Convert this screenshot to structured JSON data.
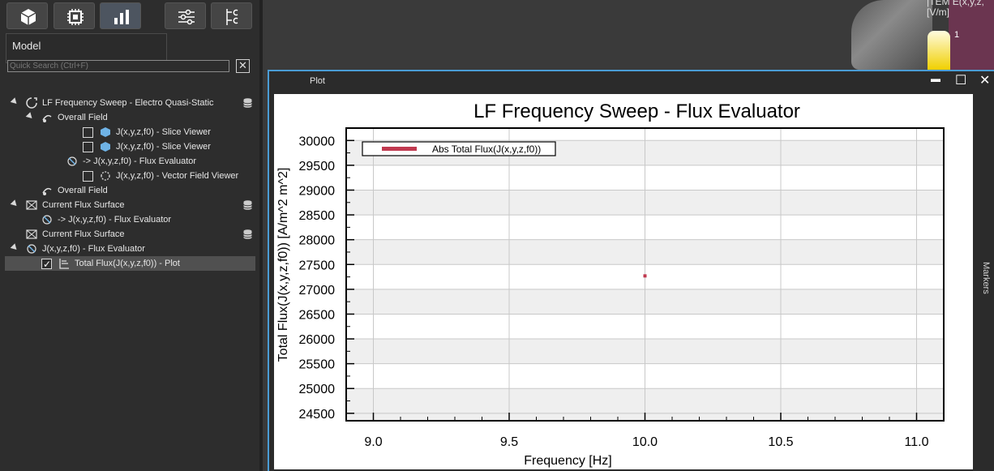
{
  "toolbar": {
    "buttons": [
      {
        "icon": "cube-icon"
      },
      {
        "icon": "chip-icon"
      },
      {
        "icon": "bar-chart-icon"
      },
      {
        "icon": "sliders-icon"
      },
      {
        "icon": "tree-structure-icon"
      }
    ]
  },
  "tooltip": {
    "label": "Model"
  },
  "search": {
    "placeholder": "Quick Search (Ctrl+F)",
    "clear": "✕"
  },
  "tree": [
    {
      "label": "LF Frequency Sweep - Electro Quasi-Static",
      "indent": 0,
      "arrow": true,
      "checkbox": null,
      "icon": "sweep-icon",
      "db": true
    },
    {
      "label": "Overall Field",
      "indent": 1,
      "arrow": true,
      "checkbox": null,
      "icon": "field-icon",
      "db": false
    },
    {
      "label": "J(x,y,z,f0) - Slice Viewer",
      "indent": 2,
      "arrow": false,
      "checkbox": false,
      "icon": "slice-viewer-icon",
      "db": false
    },
    {
      "label": "J(x,y,z,f0) - Slice Viewer",
      "indent": 2,
      "arrow": false,
      "checkbox": false,
      "icon": "slice-viewer-icon",
      "db": false
    },
    {
      "label": "-> J(x,y,z,f0) - Flux Evaluator",
      "indent": 2,
      "arrow": false,
      "checkbox": null,
      "icon": "flux-evaluator-icon",
      "db": false
    },
    {
      "label": "J(x,y,z,f0) - Vector Field Viewer",
      "indent": 2,
      "arrow": false,
      "checkbox": false,
      "icon": "vector-field-icon",
      "db": false
    },
    {
      "label": "Overall Field",
      "indent": 1,
      "arrow": false,
      "checkbox": null,
      "icon": "field-icon",
      "db": false
    },
    {
      "label": "Current Flux Surface",
      "indent": 0,
      "arrow": true,
      "checkbox": null,
      "icon": "surface-icon",
      "db": true
    },
    {
      "label": "-> J(x,y,z,f0) - Flux Evaluator",
      "indent": 1,
      "arrow": false,
      "checkbox": null,
      "icon": "flux-evaluator-icon",
      "db": false
    },
    {
      "label": "Current Flux Surface",
      "indent": 0,
      "arrow": false,
      "checkbox": null,
      "icon": "surface-icon",
      "db": true
    },
    {
      "label": "J(x,y,z,f0) - Flux Evaluator",
      "indent": 0,
      "arrow": true,
      "checkbox": null,
      "icon": "flux-evaluator-icon",
      "db": false
    },
    {
      "label": "Total Flux(J(x,y,z,f0)) - Plot",
      "indent": 1,
      "arrow": false,
      "checkbox": true,
      "icon": "plot-icon",
      "db": false,
      "selected": true
    }
  ],
  "colorbar": {
    "title": "|TEM E(x,y,z,\n[V/m]",
    "max_label": "1"
  },
  "plot_window": {
    "title": "Plot",
    "minimize": "▬",
    "maximize": "☐",
    "close": "✕",
    "side_tab": "Markers"
  },
  "chart_data": {
    "type": "scatter",
    "title": "LF Frequency Sweep - Flux Evaluator",
    "xlabel": "Frequency [Hz]",
    "ylabel": "Total Flux(J(x,y,z,f0)) [A/m^2 m^2]",
    "xlim": [
      8.9,
      11.1
    ],
    "ylim": [
      24350,
      30250
    ],
    "xticks": [
      "9.0",
      "9.5",
      "10.0",
      "10.5",
      "11.0"
    ],
    "yticks": [
      "24500",
      "25000",
      "25500",
      "26000",
      "26500",
      "27000",
      "27500",
      "28000",
      "28500",
      "29000",
      "29500",
      "30000"
    ],
    "series": [
      {
        "name": "Abs Total Flux(J(x,y,z,f0))",
        "color": "#c0394f",
        "x": [
          10.0
        ],
        "y": [
          27270
        ]
      }
    ],
    "grid": true,
    "legend": "top-left"
  }
}
